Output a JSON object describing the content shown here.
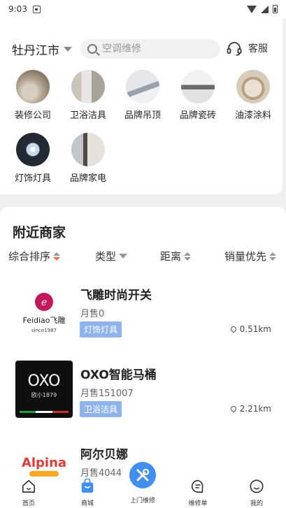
{
  "status_bar": {
    "time": "9:03"
  },
  "header": {
    "city": "牡丹江市",
    "search_placeholder": "空调维修",
    "service_label": "客服"
  },
  "categories": [
    {
      "label": "装修公司"
    },
    {
      "label": "卫浴洁具"
    },
    {
      "label": "品牌吊顶"
    },
    {
      "label": "品牌瓷砖"
    },
    {
      "label": "油漆涂料"
    },
    {
      "label": "灯饰灯具"
    },
    {
      "label": "品牌家电"
    }
  ],
  "merchants": {
    "title": "附近商家",
    "sort": {
      "comprehensive": "综合排序",
      "type": "类型",
      "distance": "距离",
      "sales_first": "销量优先"
    },
    "shops": [
      {
        "name": "飞雕时尚开关",
        "sales": "月售0",
        "tag": "灯饰灯具",
        "distance": "0.51km",
        "logo_text": "Feidiao飞雕",
        "logo_sub": "since1987"
      },
      {
        "name": "OXO智能马桶",
        "sales": "月售151007",
        "tag": "卫浴洁具",
        "distance": "2.21km",
        "logo_text": "OXO",
        "logo_sub": "欧小1879"
      },
      {
        "name": "阿尔贝娜",
        "sales": "月售4044",
        "logo_text": "Alpina"
      }
    ]
  },
  "bottom_nav": {
    "home": "首页",
    "mall": "商城",
    "repair": "上门维修",
    "orders": "维修单",
    "mine": "我的"
  }
}
